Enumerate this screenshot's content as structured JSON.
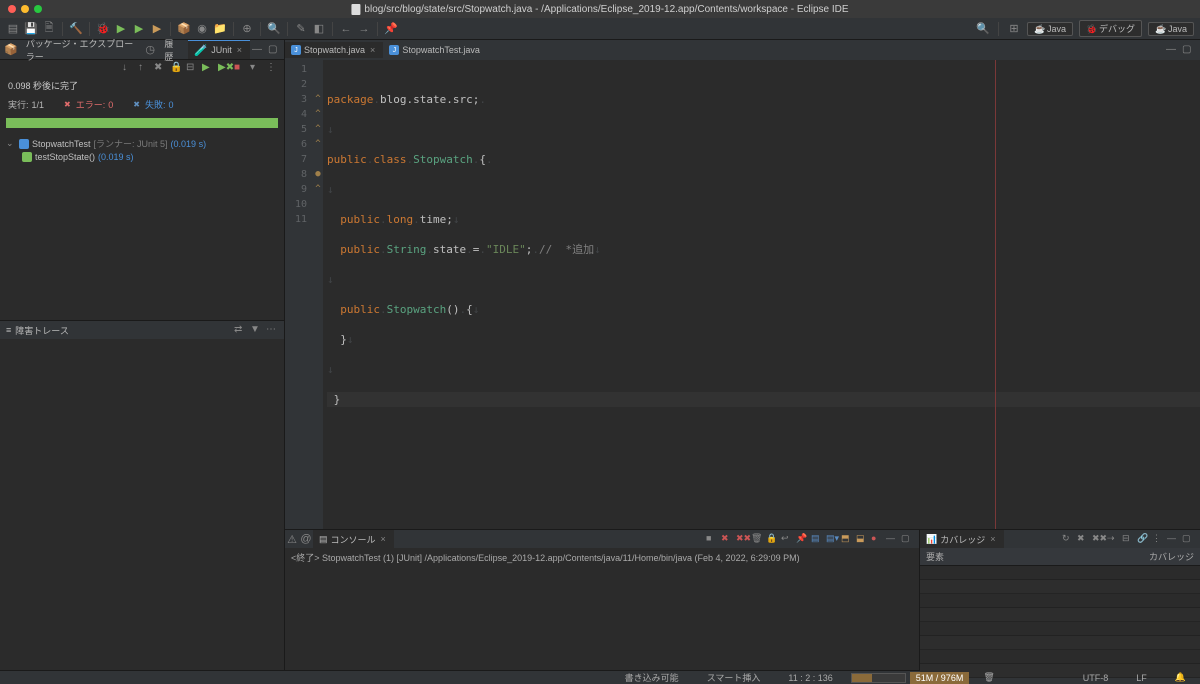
{
  "window": {
    "title": "blog/src/blog/state/src/Stopwatch.java - /Applications/Eclipse_2019-12.app/Contents/workspace - Eclipse IDE"
  },
  "perspectives": {
    "java": "Java",
    "debug": "デバッグ",
    "js": "Java"
  },
  "left": {
    "pkg_tab": "パッケージ・エクスプローラー",
    "history_tab": "履歴",
    "junit_tab": "JUnit",
    "finished": "0.098 秒後に完了",
    "runs_label": "実行:",
    "runs_value": "1/1",
    "err_label": "エラー:",
    "err_value": "0",
    "fail_label": "失敗:",
    "fail_value": "0",
    "tests": {
      "root": "StopwatchTest",
      "runner": "[ランナー: JUnit 5]",
      "root_time": "(0.019 s)",
      "child": "testStopState()",
      "child_time": "(0.019 s)"
    },
    "trace_label": "障害トレース"
  },
  "editor": {
    "tab1": "Stopwatch.java",
    "tab2": "StopwatchTest.java",
    "lines": [
      "1",
      "2",
      "3",
      "4",
      "5",
      "6",
      "7",
      "8",
      "9",
      "10",
      "11"
    ],
    "ann": [
      "",
      "",
      "",
      "",
      "",
      "",
      "",
      "●",
      "",
      ""
    ],
    "code": {
      "l1a": "package",
      "l1b": "blog.state.src",
      "l1c": ";",
      "l3a": "public",
      "l3b": "class",
      "l3c": "Stopwatch",
      "l3d": "{",
      "l5a": "public",
      "l5b": "long",
      "l5c": "time",
      "l5d": ";",
      "l6a": "public",
      "l6b": "String",
      "l6c": "state",
      "l6d": "=",
      "l6e": "\"IDLE\"",
      "l6f": ";",
      "l6g": "//",
      "l6h": "*追加",
      "l8a": "public",
      "l8b": "Stopwatch",
      "l8c": "()",
      "l8d": "{",
      "l9a": "}",
      "l11a": "}"
    }
  },
  "console": {
    "tab": "コンソール",
    "line": "<終了> StopwatchTest (1) [JUnit] /Applications/Eclipse_2019-12.app/Contents/java/11/Home/bin/java (Feb 4, 2022, 6:29:09 PM)"
  },
  "coverage": {
    "tab": "カバレッジ",
    "col1": "要素",
    "col2": "カバレッジ"
  },
  "status": {
    "writable": "書き込み可能",
    "insert": "スマート挿入",
    "pos": "11 : 2 : 136",
    "mem": "51M / 976M",
    "enc": "UTF-8",
    "le": "LF"
  }
}
